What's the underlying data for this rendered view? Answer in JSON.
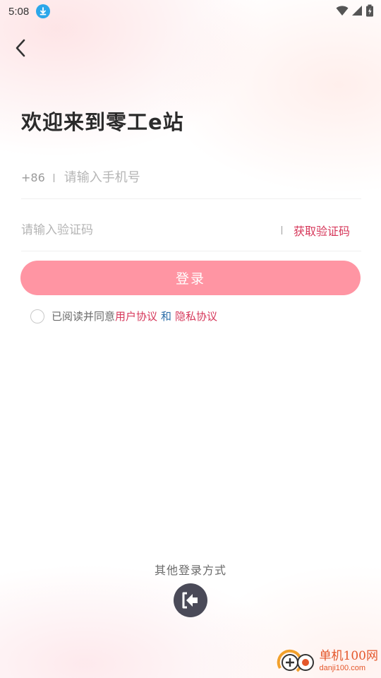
{
  "status_bar": {
    "time": "5:08"
  },
  "header": {
    "title": "欢迎来到零工e站"
  },
  "phone": {
    "country_code": "+86",
    "placeholder": "请输入手机号"
  },
  "code": {
    "placeholder": "请输入验证码",
    "get_code_label": "获取验证码"
  },
  "login_button_label": "登录",
  "agreement": {
    "prefix": "已阅读并同意",
    "user_agreement": "用户协议",
    "and": "和",
    "privacy_policy": "隐私协议"
  },
  "other_login": {
    "label": "其他登录方式",
    "icon": "login-arrow-icon"
  },
  "watermark": {
    "name": "单机100网",
    "url": "danji100.com"
  },
  "colors": {
    "accent": "#d6375a",
    "button": "#ff95a3",
    "link_and": "#2e6fa8",
    "icon_button": "#4a4a58"
  }
}
